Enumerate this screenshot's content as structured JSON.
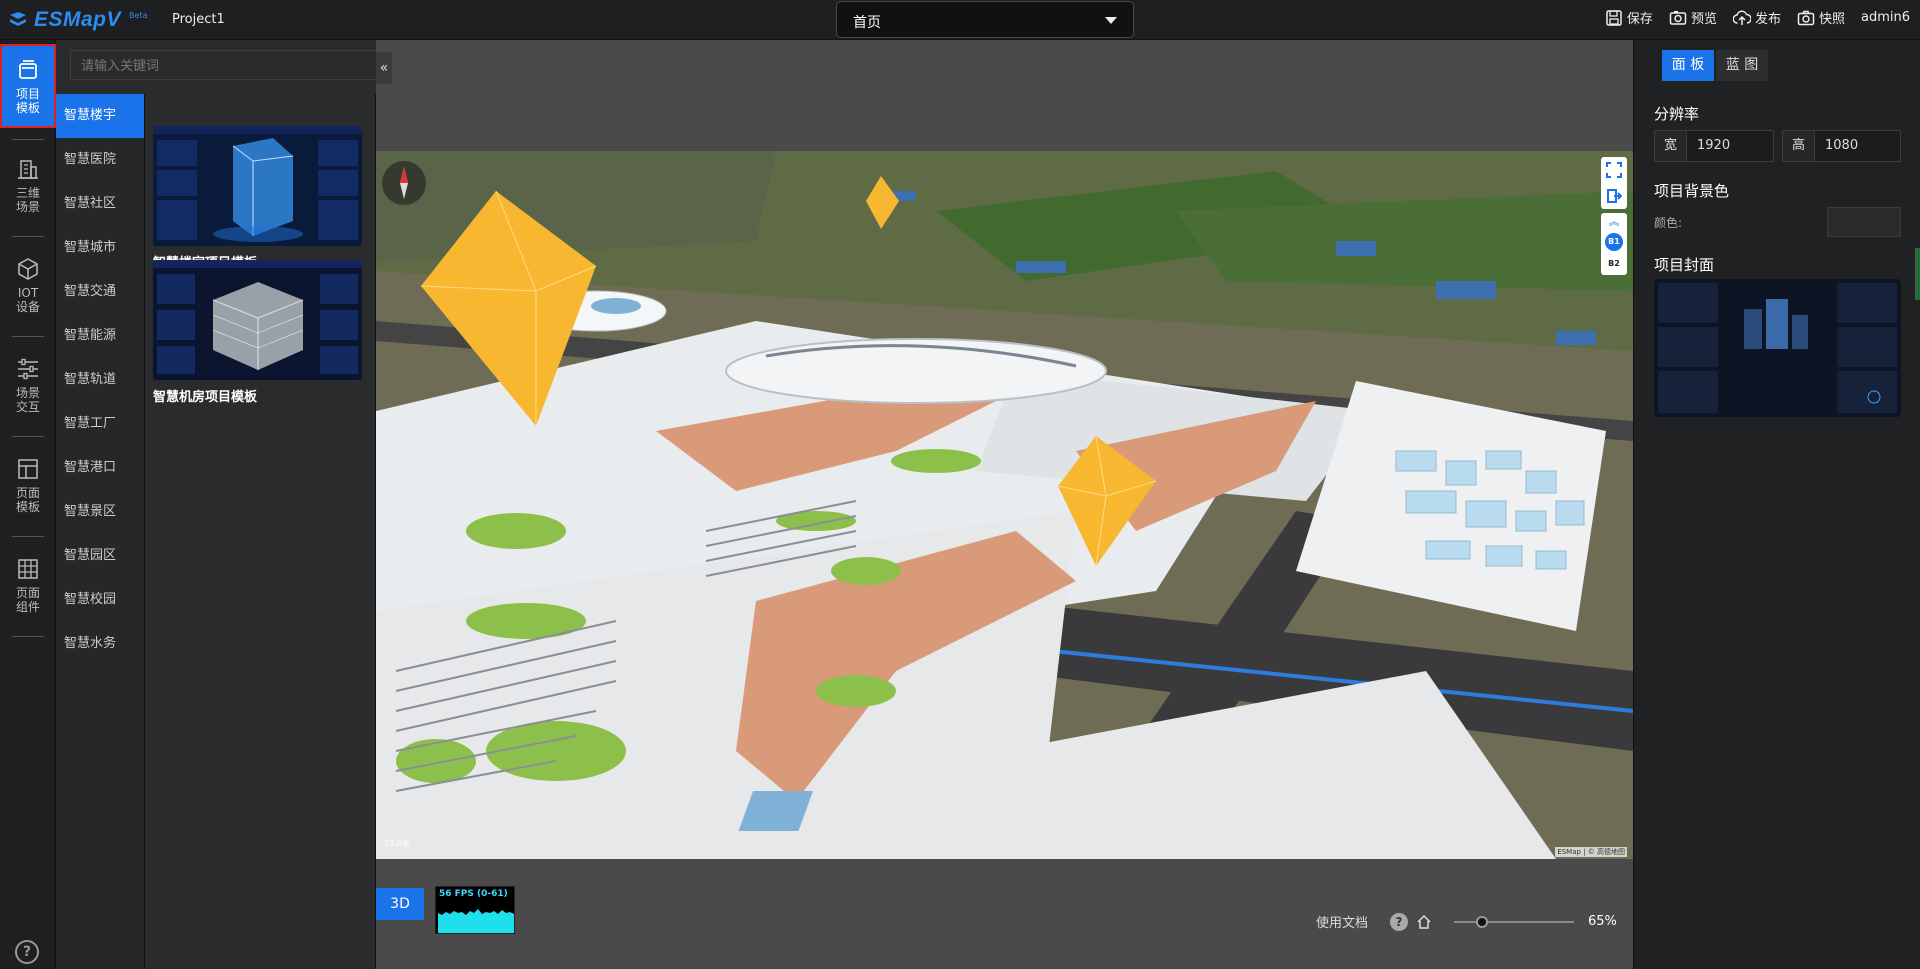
{
  "header": {
    "logo": "ESMapV",
    "logo_tag": "Beta",
    "project_name": "Project1",
    "page_select": {
      "value": "首页"
    },
    "actions": [
      {
        "label": "保存",
        "icon": "save-icon"
      },
      {
        "label": "预览",
        "icon": "preview-icon"
      },
      {
        "label": "发布",
        "icon": "publish-icon"
      },
      {
        "label": "快照",
        "icon": "camera-icon"
      }
    ],
    "user": "admin6"
  },
  "rail": {
    "items": [
      {
        "label": "项目\n模板",
        "icon": "template-icon",
        "active": true
      },
      {
        "label": "三维\n场景",
        "icon": "building-icon"
      },
      {
        "label": "IOT\n设备",
        "icon": "cube-icon"
      },
      {
        "label": "场景\n交互",
        "icon": "sliders-icon"
      },
      {
        "label": "页面\n模板",
        "icon": "layout-icon"
      },
      {
        "label": "页面\n组件",
        "icon": "grid-icon"
      }
    ],
    "help": "?"
  },
  "search": {
    "placeholder": "请输入关键词"
  },
  "categories": [
    "智慧楼宇",
    "智慧医院",
    "智慧社区",
    "智慧城市",
    "智慧交通",
    "智慧能源",
    "智慧轨道",
    "智慧工厂",
    "智慧港口",
    "智慧景区",
    "智慧园区",
    "智慧校园",
    "智慧水务"
  ],
  "templates": [
    {
      "name": "智慧楼宇项目模板"
    },
    {
      "name": "智慧机房项目模板"
    }
  ],
  "canvas": {
    "mode": "3D",
    "fps": "56 FPS (0-61)",
    "docs": "使用文档",
    "zoom": "65%",
    "zoom_fraction": 0.2,
    "scale_label": "23.0米",
    "attribution": "ESMap | © 高德地图",
    "floors": [
      "B1",
      "B2"
    ]
  },
  "right_panel": {
    "tabs": [
      "面 板",
      "蓝 图"
    ],
    "resolution_title": "分辨率",
    "width_label": "宽",
    "width_value": "1920",
    "height_label": "高",
    "height_value": "1080",
    "bg_title": "项目背景色",
    "color_label": "颜色:",
    "cover_title": "项目封面"
  },
  "colors": {
    "accent": "#1a73e8",
    "marker": "#f7b731"
  }
}
